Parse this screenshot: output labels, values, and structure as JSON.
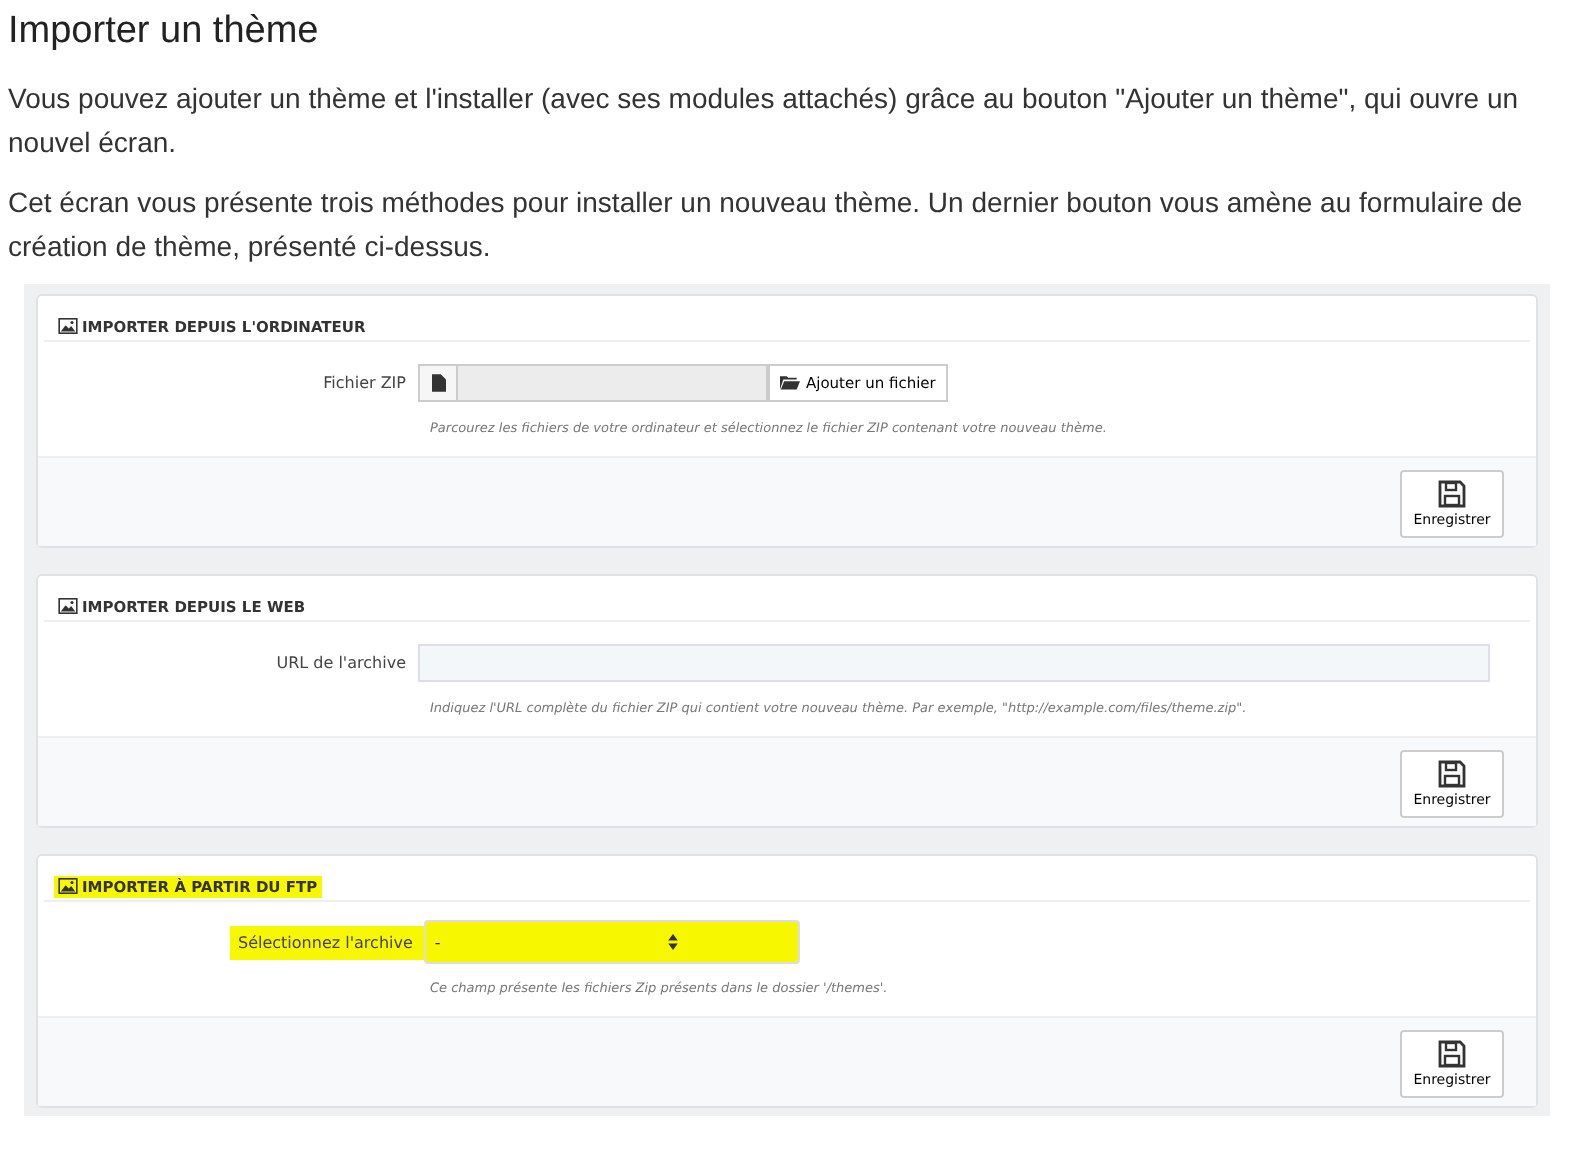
{
  "heading": "Importer un thème",
  "paragraphs": [
    "Vous pouvez ajouter un thème et l'installer (avec ses modules attachés) grâce au bouton \"Ajouter un thème\", qui ouvre un nouvel écran.",
    "Cet écran vous présente trois méthodes pour installer un nouveau thème. Un dernier bouton vous amène au formulaire de création de thème, présenté ci-dessus."
  ],
  "panels": [
    {
      "title": "IMPORTER DEPUIS L'ORDINATEUR",
      "highlighted": false,
      "kind": "file",
      "label": "Fichier ZIP",
      "button": "Ajouter un fichier",
      "help": "Parcourez les fichiers de votre ordinateur et sélectionnez le fichier ZIP contenant votre nouveau thème.",
      "save": "Enregistrer"
    },
    {
      "title": "IMPORTER DEPUIS LE WEB",
      "highlighted": false,
      "kind": "text",
      "label": "URL de l'archive",
      "help": "Indiquez l'URL complète du fichier ZIP qui contient votre nouveau thème. Par exemple, \"http://example.com/files/theme.zip\".",
      "save": "Enregistrer"
    },
    {
      "title": "IMPORTER À PARTIR DU FTP",
      "highlighted": true,
      "kind": "select",
      "label": "Sélectionnez l'archive",
      "value": "-",
      "help": "Ce champ présente les fichiers Zip présents dans le dossier '/themes'.",
      "save": "Enregistrer"
    }
  ]
}
